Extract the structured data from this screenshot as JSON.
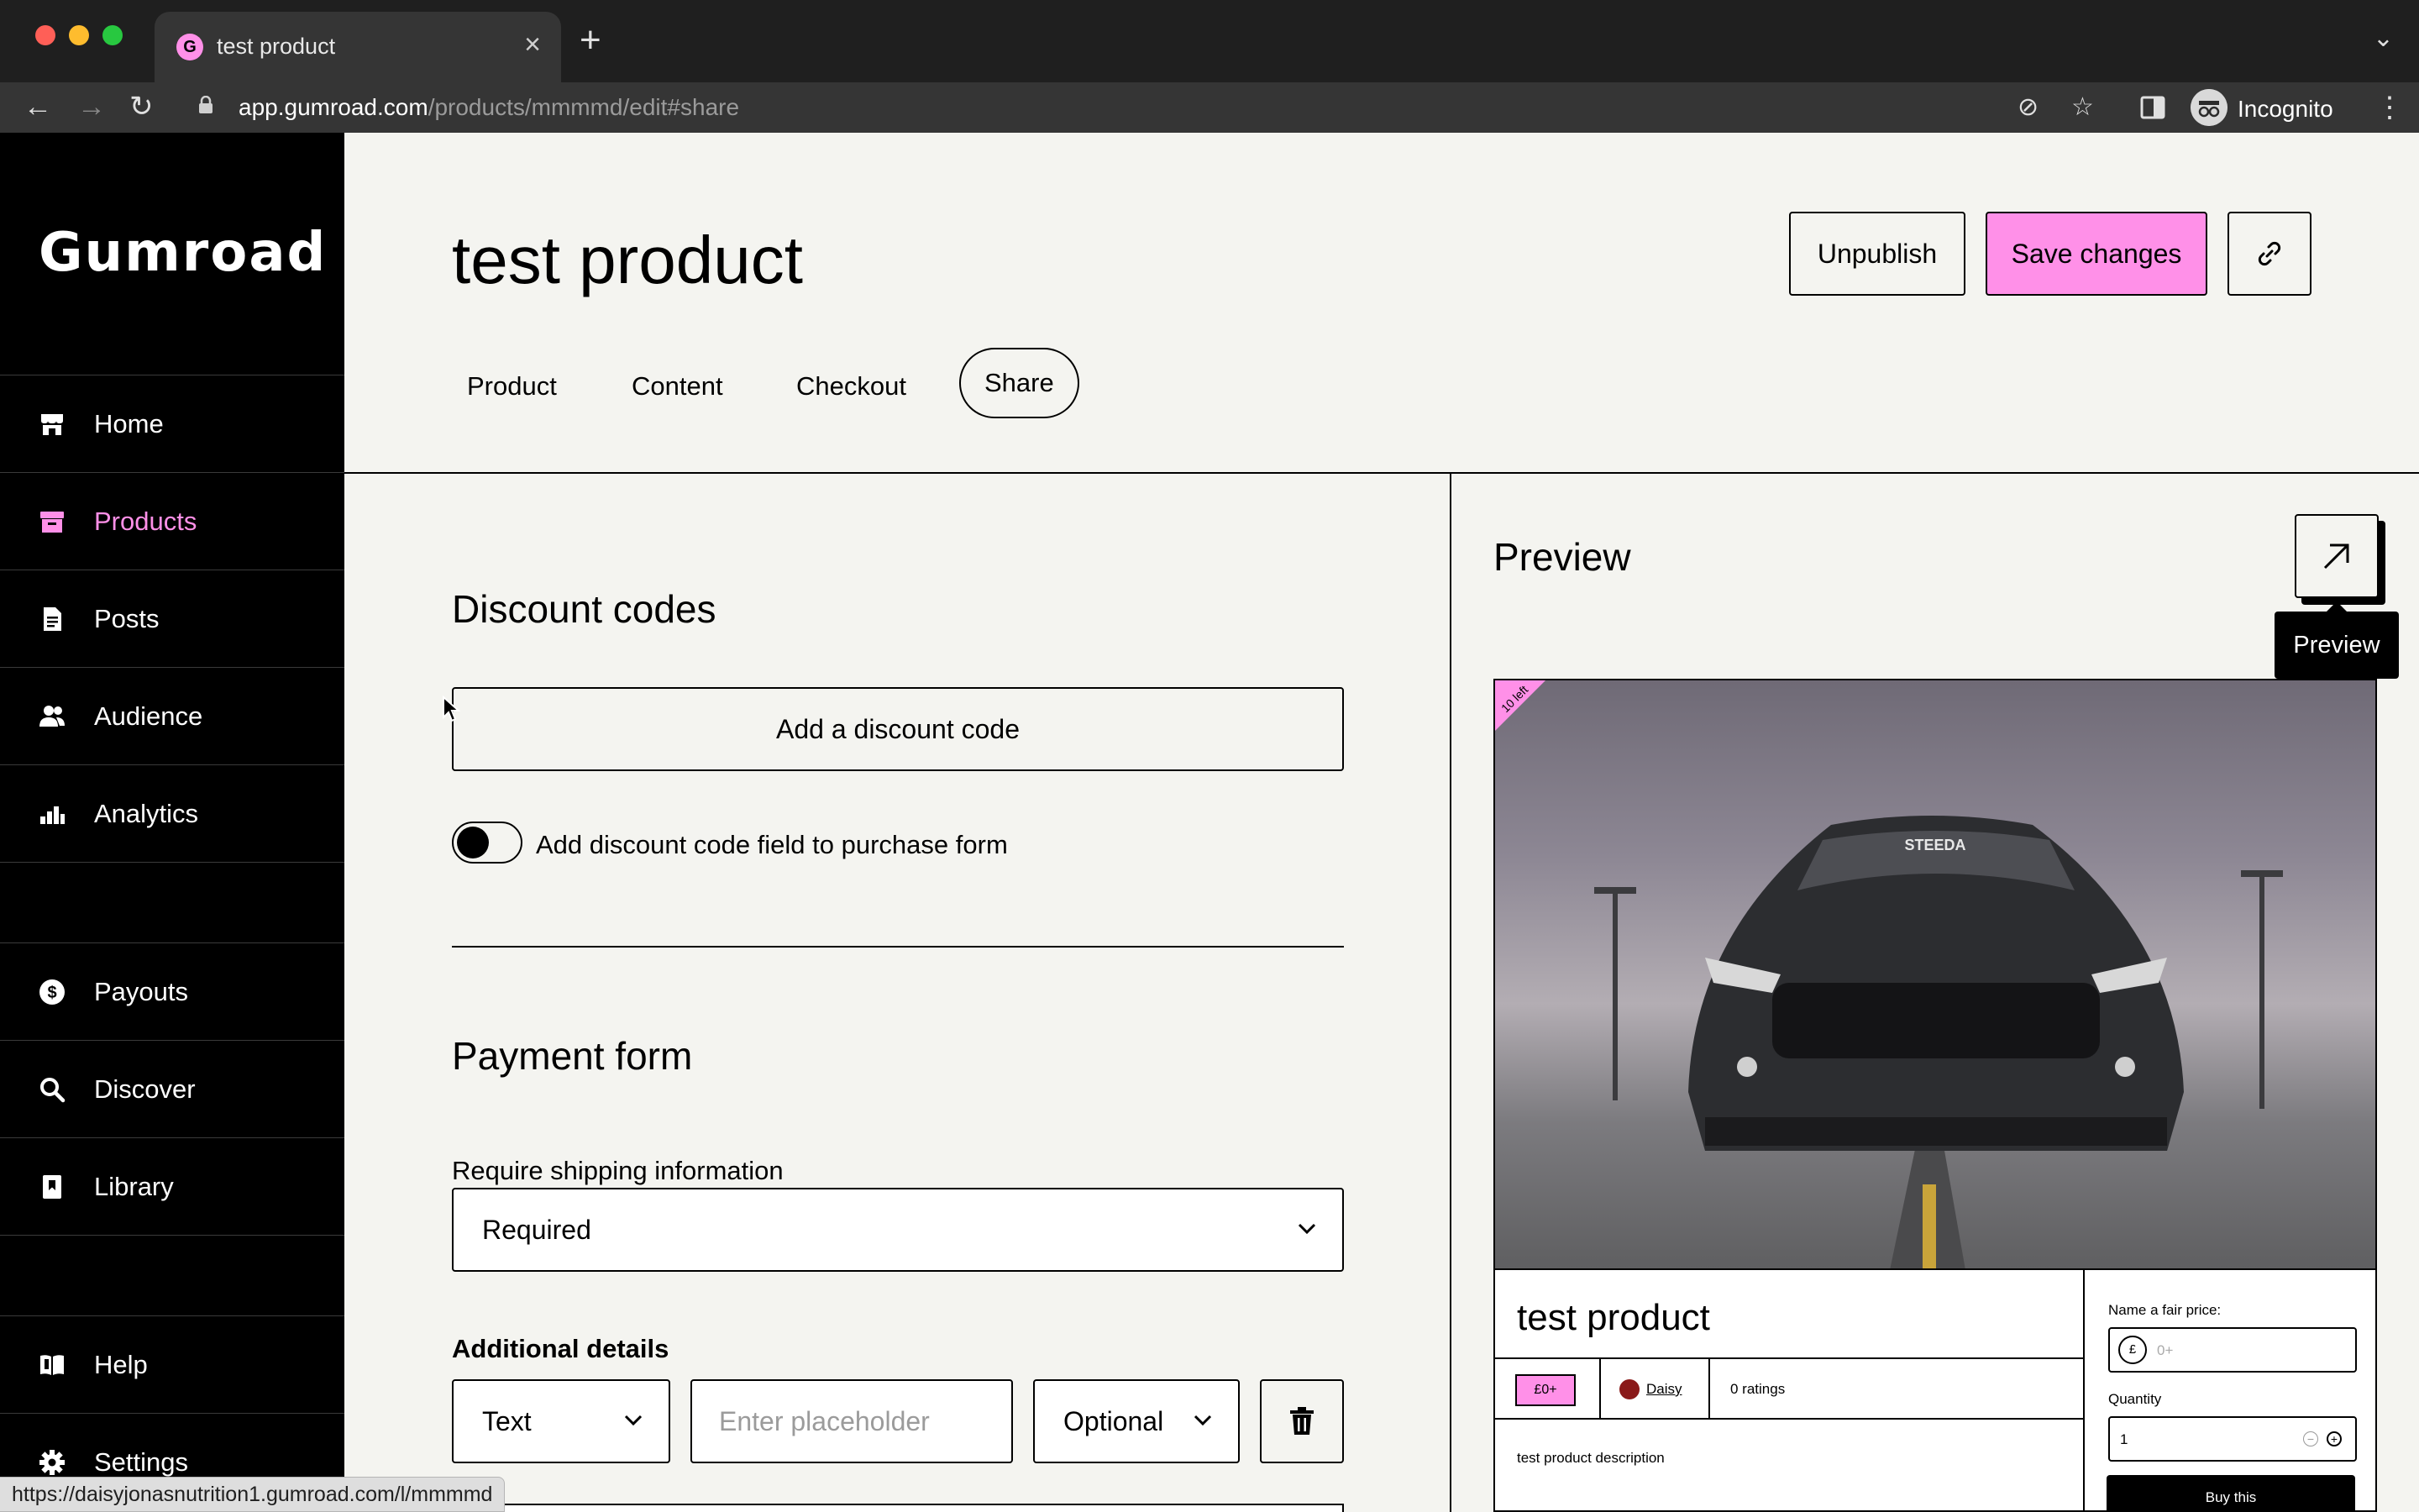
{
  "browser": {
    "tab_title": "test product",
    "tab_favicon": "G",
    "url_host": "app.gumroad.com",
    "url_path": "/products/mmmmd/edit#share",
    "profile_label": "Incognito",
    "status_url": "https://daisyjonasnutrition1.gumroad.com/l/mmmmd"
  },
  "sidebar": {
    "logo": "Gumroad",
    "items": [
      {
        "label": "Home",
        "icon": "store-icon"
      },
      {
        "label": "Products",
        "icon": "archive-icon"
      },
      {
        "label": "Posts",
        "icon": "document-icon"
      },
      {
        "label": "Audience",
        "icon": "people-icon"
      },
      {
        "label": "Analytics",
        "icon": "bar-chart-icon"
      },
      {
        "label": "Payouts",
        "icon": "dollar-circle-icon"
      },
      {
        "label": "Discover",
        "icon": "search-icon"
      },
      {
        "label": "Library",
        "icon": "bookmark-icon"
      },
      {
        "label": "Help",
        "icon": "book-icon"
      },
      {
        "label": "Settings",
        "icon": "gear-icon"
      }
    ],
    "active": "Products"
  },
  "header": {
    "title": "test product",
    "unpublish_label": "Unpublish",
    "save_label": "Save changes",
    "tabs": [
      {
        "label": "Product"
      },
      {
        "label": "Content"
      },
      {
        "label": "Checkout"
      },
      {
        "label": "Share"
      }
    ],
    "active_tab": "Share"
  },
  "discount": {
    "heading": "Discount codes",
    "add_button": "Add a discount code",
    "toggle_label": "Add discount code field to purchase form"
  },
  "payment_form": {
    "heading": "Payment form",
    "shipping_label": "Require shipping information",
    "shipping_value": "Required",
    "additional_label": "Additional details",
    "field_type": "Text",
    "placeholder_hint": "Enter placeholder",
    "requirement": "Optional"
  },
  "preview": {
    "heading": "Preview",
    "tooltip": "Preview",
    "ribbon": "10 left",
    "product_title": "test product",
    "price_tag": "£0+",
    "creator": "Daisy",
    "ratings": "0 ratings",
    "description": "test product description",
    "fair_price_label": "Name a fair price:",
    "currency_symbol": "£",
    "price_placeholder": "0+",
    "quantity_label": "Quantity",
    "quantity_value": "1",
    "buy_label": "Buy this"
  },
  "colors": {
    "brand_pink": "#ff90e8",
    "background": "#f4f4f0",
    "sidebar": "#000000"
  }
}
